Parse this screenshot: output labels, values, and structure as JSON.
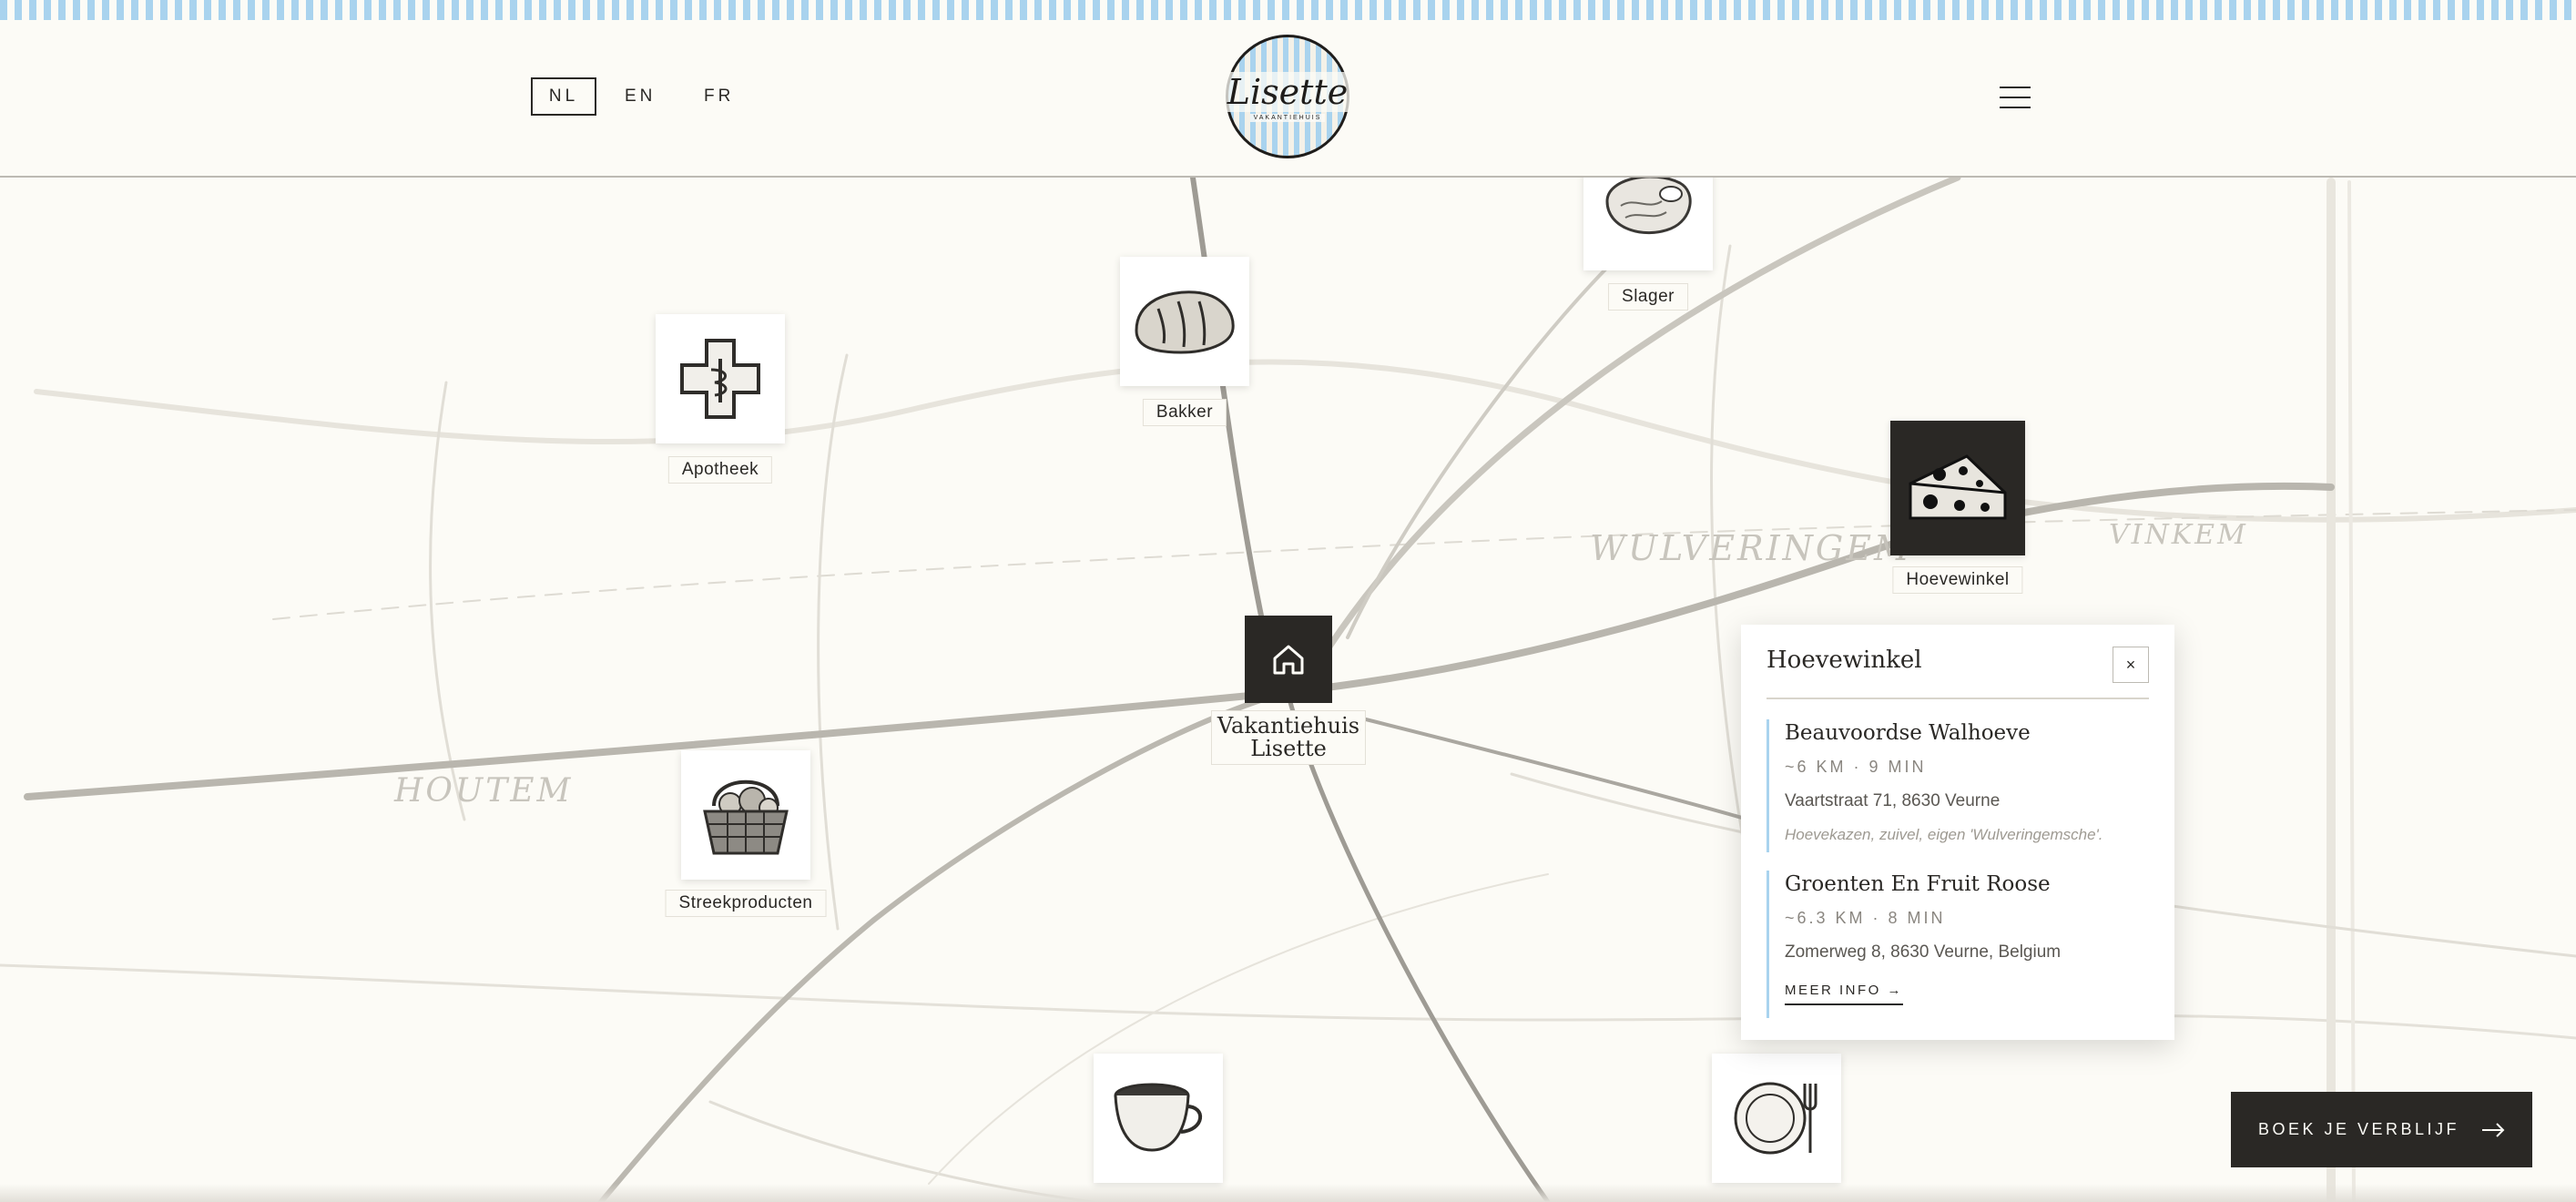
{
  "header": {
    "languages": [
      {
        "label": "NL",
        "active": true
      },
      {
        "label": "EN",
        "active": false
      },
      {
        "label": "FR",
        "active": false
      }
    ],
    "logo": {
      "name": "Lisette",
      "subtitle": "VAKANTIEHUIS"
    },
    "menu_icon": "hamburger-menu-icon"
  },
  "map": {
    "regions": [
      "WULVERINGEM",
      "VINKEM",
      "HOUTEM"
    ],
    "home": {
      "icon": "home-icon",
      "label_line1": "Vakantiehuis",
      "label_line2": "Lisette"
    },
    "pois": [
      {
        "key": "slager",
        "label": "Slager",
        "icon": "steak-icon"
      },
      {
        "key": "bakker",
        "label": "Bakker",
        "icon": "bread-icon"
      },
      {
        "key": "apotheek",
        "label": "Apotheek",
        "icon": "pharmacy-cross-icon"
      },
      {
        "key": "hoevewinkel",
        "label": "Hoevewinkel",
        "icon": "cheese-icon",
        "active": true
      },
      {
        "key": "streekproducten",
        "label": "Streekproducten",
        "icon": "basket-icon"
      },
      {
        "key": "koffie",
        "label": "",
        "icon": "coffee-cup-icon"
      },
      {
        "key": "restaurant",
        "label": "",
        "icon": "plate-cutlery-icon"
      }
    ]
  },
  "panel": {
    "title": "Hoevewinkel",
    "close_label": "×",
    "entries": [
      {
        "name": "Beauvoordse Walhoeve",
        "distance": "~6 KM · 9 MIN",
        "address": "Vaartstraat 71, 8630 Veurne",
        "note": "Hoevekazen, zuivel, eigen 'Wulveringemsche'."
      },
      {
        "name": "Groenten En Fruit Roose",
        "distance": "~6.3 KM · 8 MIN",
        "address": "Zomerweg 8, 8630 Veurne, Belgium",
        "more": "MEER INFO →"
      }
    ]
  },
  "cta": {
    "label": "BOEK JE VERBLIJF",
    "icon": "arrow-right-icon"
  },
  "colors": {
    "accent_blue": "#a9d3ee",
    "dark": "#2a2825",
    "background": "#fcfbf6"
  }
}
